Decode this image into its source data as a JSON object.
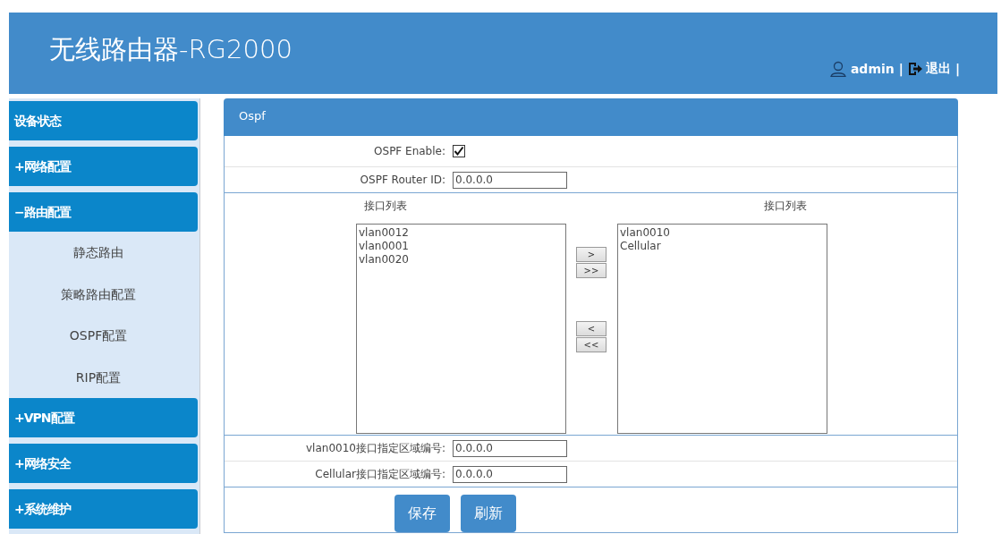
{
  "header": {
    "title": "无线路由器-RG2000",
    "user": "admin",
    "separator_1": "|",
    "logout": "退出",
    "separator_2": "|"
  },
  "sidebar": {
    "items": [
      {
        "label": "设备状态"
      },
      {
        "label": "+网络配置"
      },
      {
        "label": "−路由配置",
        "children": [
          {
            "label": "静态路由"
          },
          {
            "label": "策略路由配置"
          },
          {
            "label": "OSPF配置"
          },
          {
            "label": "RIP配置"
          }
        ]
      },
      {
        "label": "+VPN配置"
      },
      {
        "label": "+网络安全"
      },
      {
        "label": "+系统维护"
      }
    ]
  },
  "panel": {
    "title": "Ospf",
    "enable": {
      "label": "OSPF Enable:",
      "checked": true
    },
    "router_id": {
      "label": "OSPF Router ID:",
      "value": "0.0.0.0"
    },
    "left_list": {
      "label": "接口列表",
      "items": [
        "vlan0012",
        "vlan0001",
        "vlan0020"
      ]
    },
    "transfer_buttons": [
      ">",
      ">>",
      "<",
      "<<"
    ],
    "right_list": {
      "label": "接口列表",
      "items": [
        "vlan0010",
        "Cellular"
      ]
    },
    "areas": [
      {
        "label": "vlan0010接口指定区域编号:",
        "value": "0.0.0.0"
      },
      {
        "label": "Cellular接口指定区域编号:",
        "value": "0.0.0.0"
      }
    ],
    "buttons": [
      "保存",
      "刷新"
    ]
  }
}
